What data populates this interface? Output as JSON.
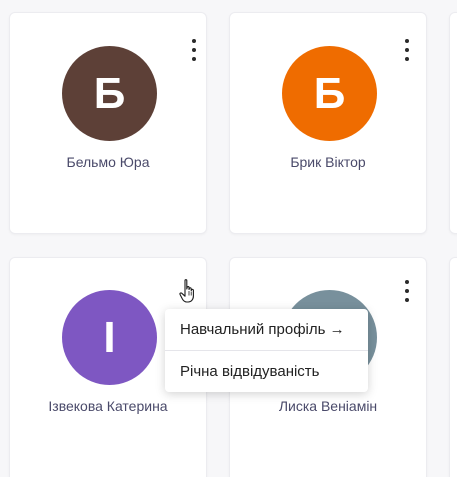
{
  "cards": [
    {
      "initial": "Б",
      "name": "Бельмо Юра",
      "color": "#5d4037"
    },
    {
      "initial": "Б",
      "name": "Брик Віктор",
      "color": "#ef6c00"
    },
    {
      "initial": "І",
      "name": "Ізвекова Катерина",
      "color": "#7e57c2"
    },
    {
      "initial": "",
      "name": "Лиска Веніамін",
      "color": "#78909c"
    }
  ],
  "menu": {
    "items": [
      {
        "label": "Навчальний профіль →"
      },
      {
        "label": "Річна відвідуваність"
      }
    ]
  },
  "icons": {
    "kebab": "more-vert-icon",
    "cursor": "hand-pointer-icon"
  }
}
